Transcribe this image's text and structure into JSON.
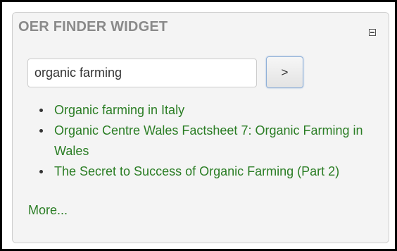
{
  "widget": {
    "title": "OER FINDER WIDGET",
    "collapse_icon": "minus-square-icon"
  },
  "search": {
    "value": "organic farming",
    "button_label": ">"
  },
  "results": [
    {
      "title": "Organic farming in Italy"
    },
    {
      "title": "Organic Centre Wales Factsheet 7: Organic Farming in Wales"
    },
    {
      "title": "The Secret to Success of Organic Farming (Part 2)"
    }
  ],
  "more_link": "More...",
  "colors": {
    "link": "#2a7d24",
    "title": "#8a8a8a",
    "panel_bg": "#f4f4f4",
    "button_focus_border": "#8fb0d8"
  }
}
